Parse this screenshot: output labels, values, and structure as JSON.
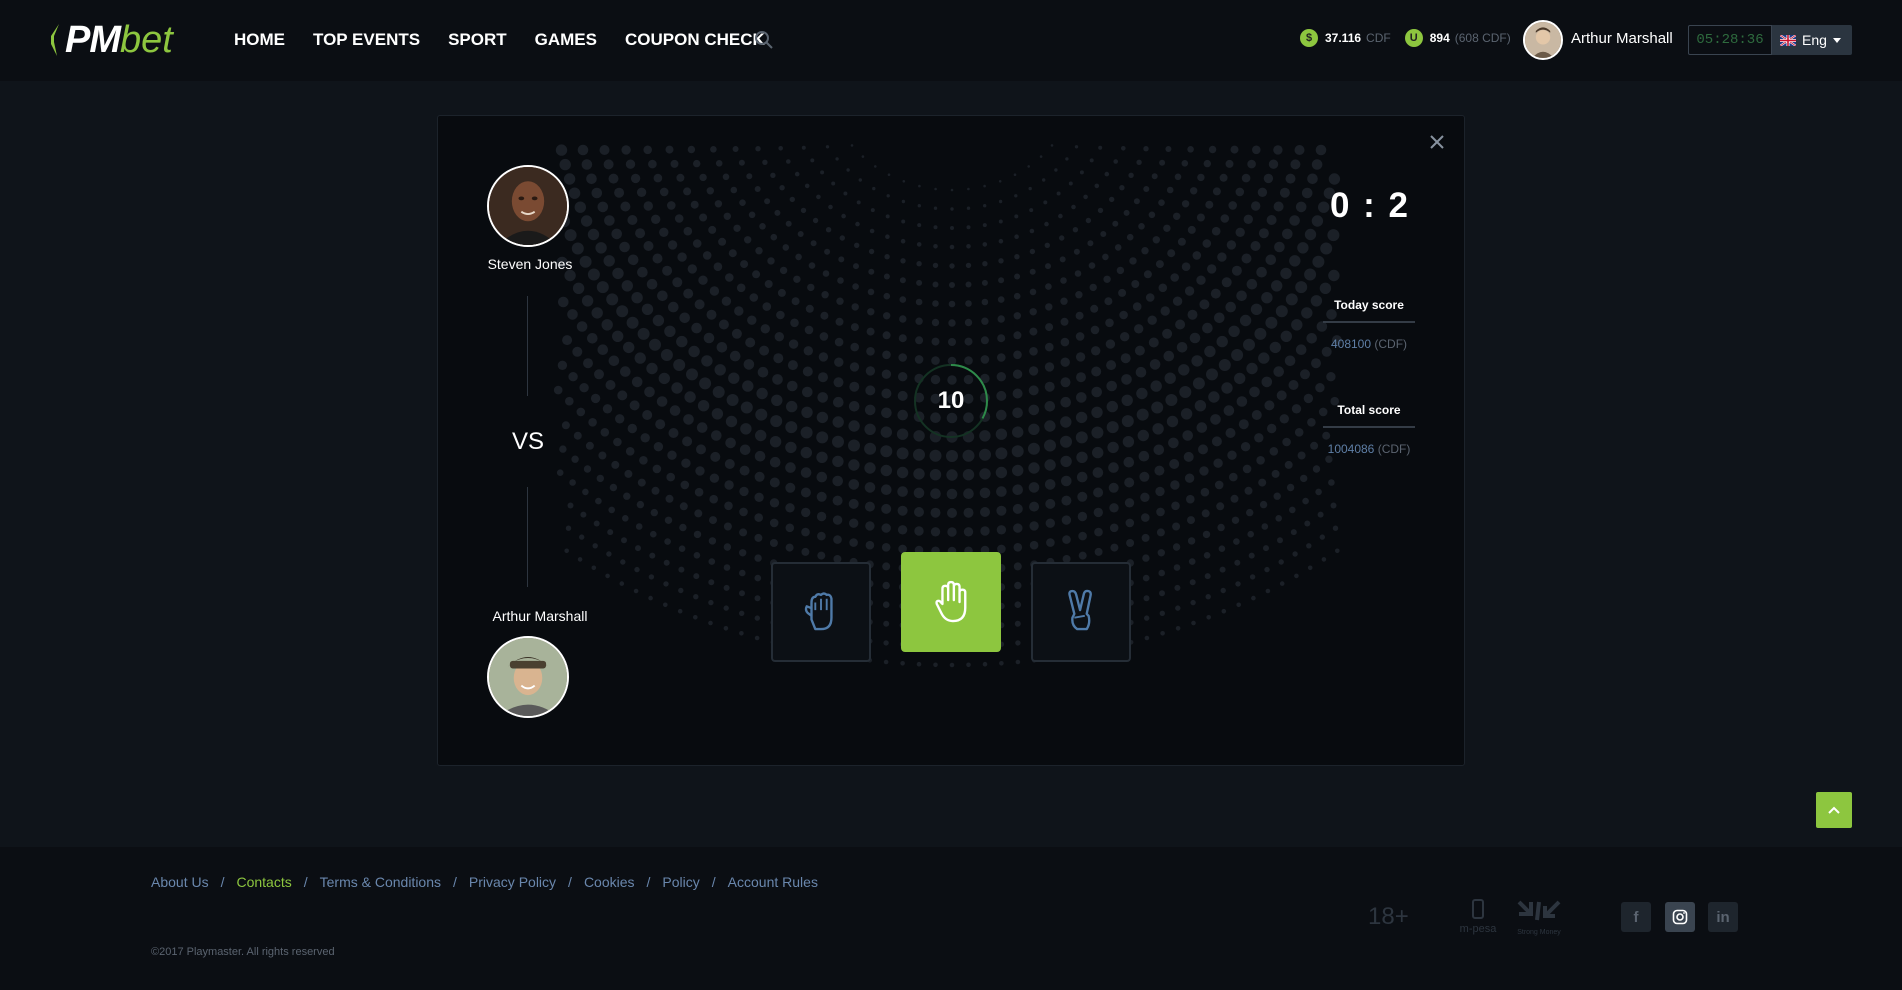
{
  "brand": {
    "logo_pm": "PM",
    "logo_bet": "bet",
    "accent": "#8dc63f"
  },
  "nav": {
    "items": [
      "HOME",
      "TOP EVENTS",
      "SPORT",
      "GAMES",
      "COUPON CHECK"
    ]
  },
  "header": {
    "balance1_value": "37.116",
    "balance1_unit": "CDF",
    "balance2_value": "894",
    "balance2_unit": "(608 CDF)",
    "user_name": "Arthur Marshall",
    "clock": "05:28:36",
    "language": "Eng"
  },
  "game": {
    "opponent_name": "Steven Jones",
    "player_name": "Arthur Marshall",
    "vs_label": "VS",
    "score": "0 : 2",
    "timer": "10",
    "timer_progress": 0.33,
    "today_score_label": "Today score",
    "today_score_value": "408100",
    "today_score_unit": "(CDF)",
    "total_score_label": "Total score",
    "total_score_value": "1004086",
    "total_score_unit": "(CDF)",
    "choices": [
      "rock",
      "paper",
      "scissors"
    ],
    "selected_choice": "paper"
  },
  "footer": {
    "links": [
      "About Us",
      "Contacts",
      "Terms & Conditions",
      "Privacy Policy",
      "Cookies",
      "Policy",
      "Account Rules"
    ],
    "active_link": "Contacts",
    "copyright": "©2017 Playmaster. All rights reserved",
    "age_badge": "18+",
    "payment_icons": [
      "m-pesa-icon",
      "strong-money-icon"
    ],
    "social_icons": [
      "facebook-icon",
      "instagram-icon",
      "linkedin-icon"
    ]
  }
}
